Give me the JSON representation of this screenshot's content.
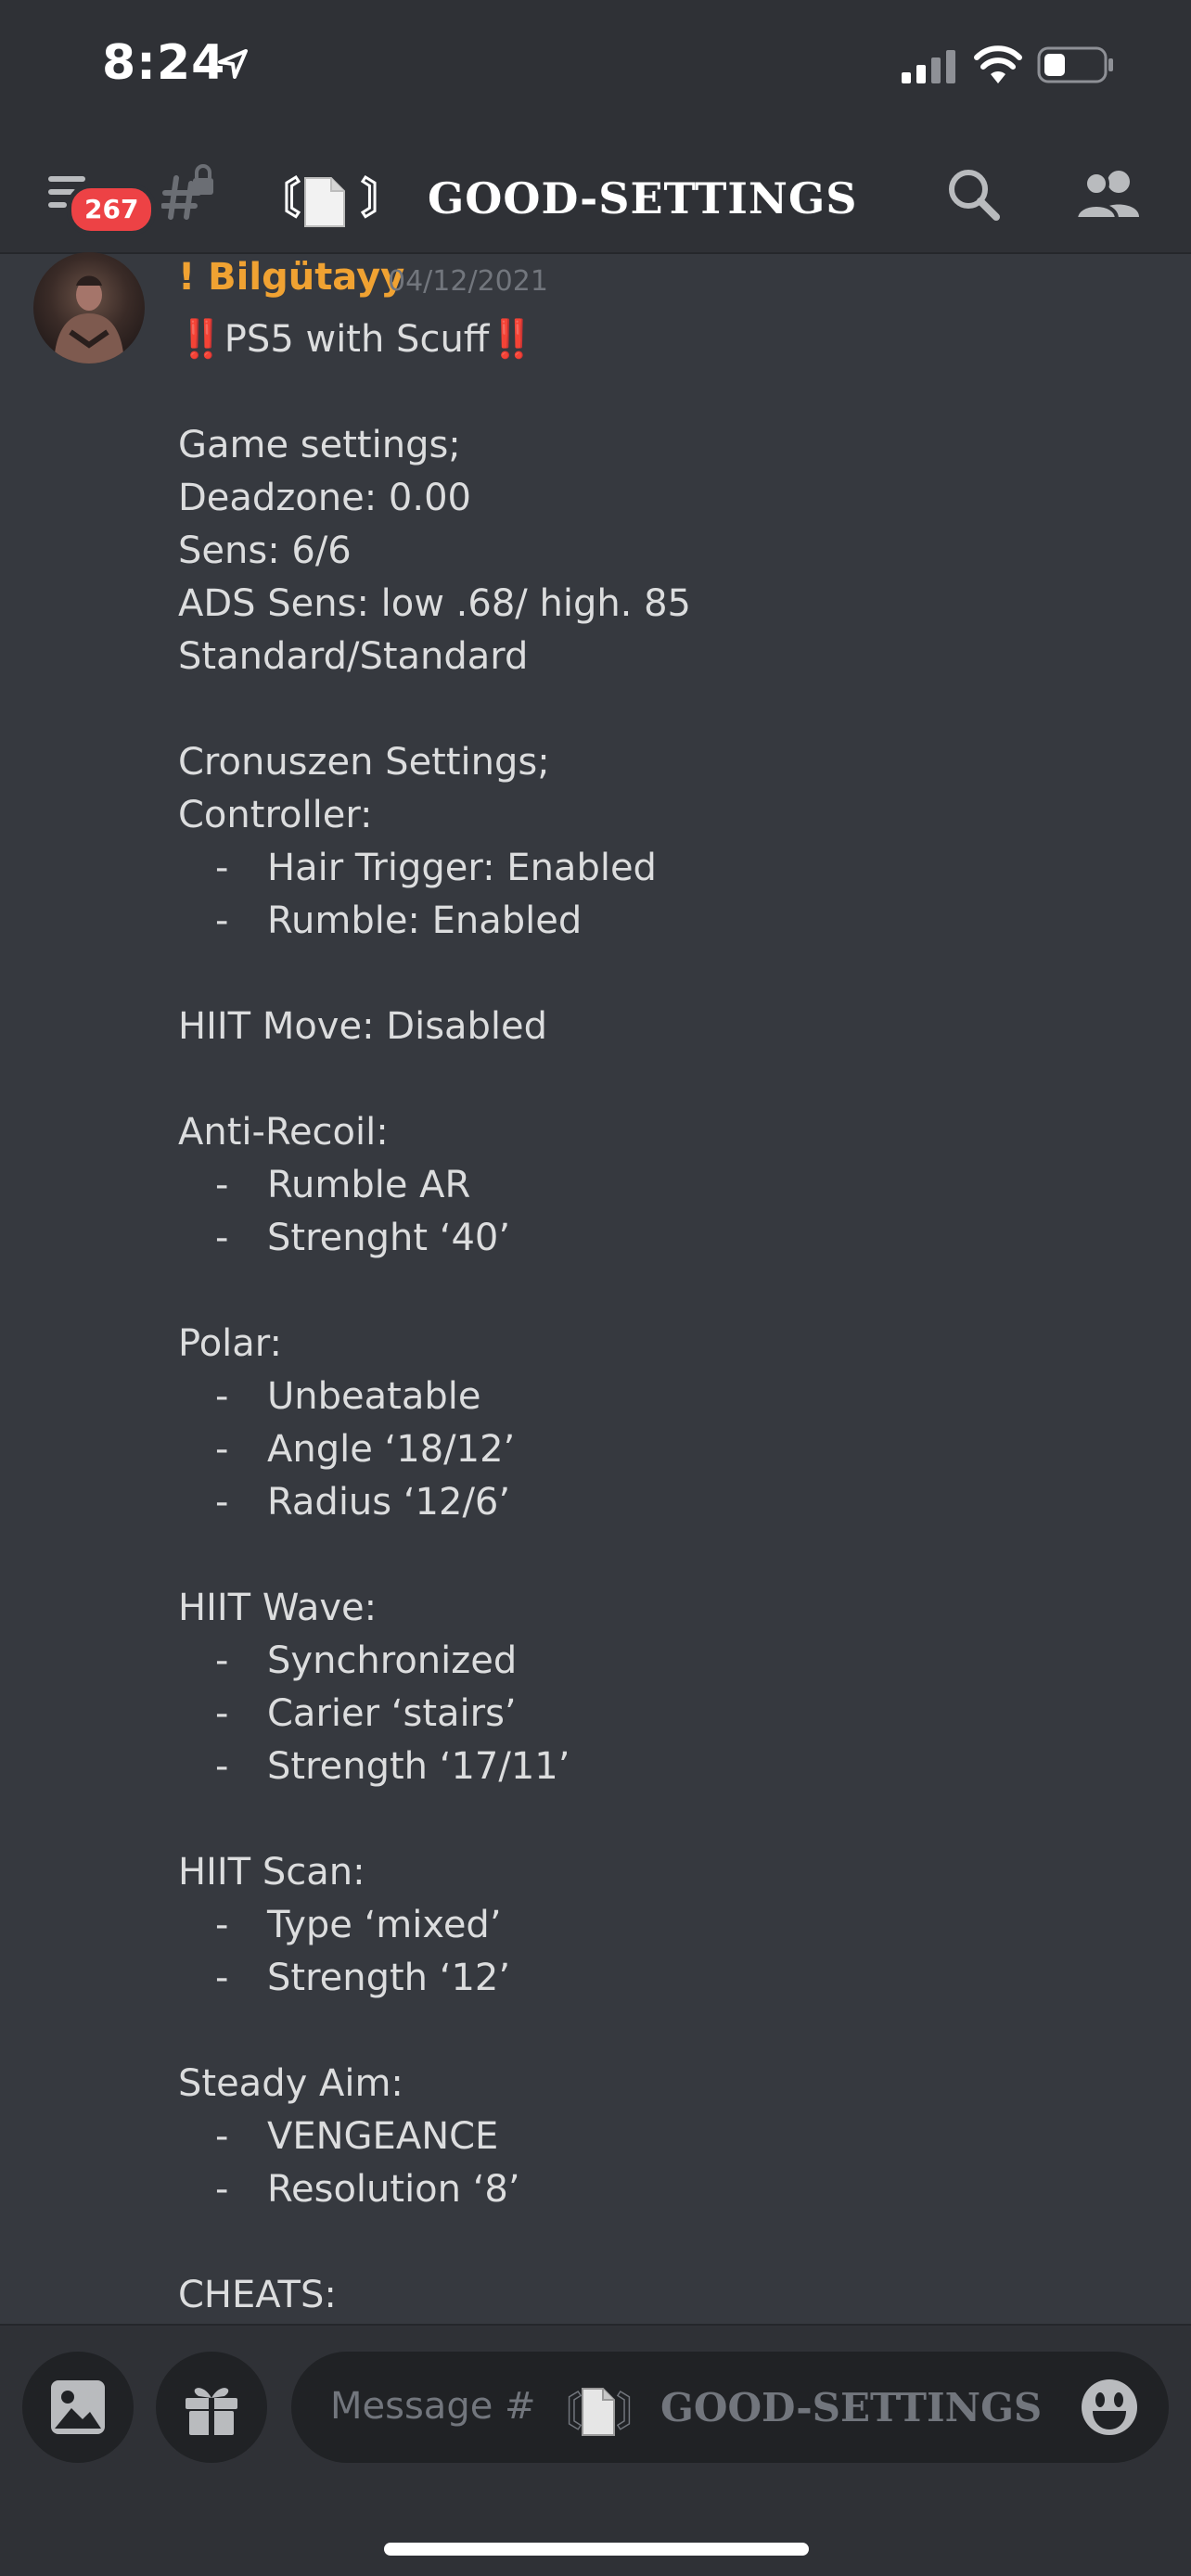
{
  "status_bar": {
    "time": "8:24"
  },
  "header": {
    "badge_count": "267",
    "channel_title": "GOOD-SETTINGS",
    "channel_brackets_left": "〘",
    "channel_brackets_right": "〙"
  },
  "message": {
    "author": "! Bilgütayy",
    "timestamp": "04/12/2021",
    "lines": [
      {
        "kind": "text",
        "text": "‼️PS5 with Scuff‼️"
      },
      {
        "kind": "blank",
        "text": ""
      },
      {
        "kind": "text",
        "text": "Game settings;"
      },
      {
        "kind": "text",
        "text": "Deadzone: 0.00"
      },
      {
        "kind": "text",
        "text": "Sens: 6/6"
      },
      {
        "kind": "text",
        "text": "ADS Sens: low .68/ high. 85"
      },
      {
        "kind": "text",
        "text": "Standard/Standard"
      },
      {
        "kind": "blank",
        "text": ""
      },
      {
        "kind": "text",
        "text": "Cronuszen Settings;"
      },
      {
        "kind": "text",
        "text": "Controller:"
      },
      {
        "kind": "bullet",
        "text": "Hair Trigger: Enabled"
      },
      {
        "kind": "bullet",
        "text": "Rumble: Enabled"
      },
      {
        "kind": "blank",
        "text": ""
      },
      {
        "kind": "text",
        "text": "HIIT Move: Disabled"
      },
      {
        "kind": "blank",
        "text": ""
      },
      {
        "kind": "text",
        "text": "Anti-Recoil:"
      },
      {
        "kind": "bullet",
        "text": "Rumble AR"
      },
      {
        "kind": "bullet",
        "text": "Strenght ‘40’"
      },
      {
        "kind": "blank",
        "text": ""
      },
      {
        "kind": "text",
        "text": "Polar:"
      },
      {
        "kind": "bullet",
        "text": "Unbeatable"
      },
      {
        "kind": "bullet",
        "text": "Angle ‘18/12’"
      },
      {
        "kind": "bullet",
        "text": "Radius ‘12/6’"
      },
      {
        "kind": "blank",
        "text": ""
      },
      {
        "kind": "text",
        "text": "HIIT Wave:"
      },
      {
        "kind": "bullet",
        "text": "Synchronized"
      },
      {
        "kind": "bullet",
        "text": "Carier ‘stairs’"
      },
      {
        "kind": "bullet",
        "text": "Strength ‘17/11’"
      },
      {
        "kind": "blank",
        "text": ""
      },
      {
        "kind": "text",
        "text": "HIIT Scan:"
      },
      {
        "kind": "bullet",
        "text": "Type ‘mixed’"
      },
      {
        "kind": "bullet",
        "text": "Strength ‘12’"
      },
      {
        "kind": "blank",
        "text": ""
      },
      {
        "kind": "text",
        "text": "Steady Aim:"
      },
      {
        "kind": "bullet",
        "text": "VENGEANCE"
      },
      {
        "kind": "bullet",
        "text": "Resolution ‘8’"
      },
      {
        "kind": "blank",
        "text": ""
      },
      {
        "kind": "text",
        "text": "CHEATS:"
      }
    ]
  },
  "composer": {
    "placeholder_prefix": "Message #",
    "placeholder_channel": "GOOD-SETTINGS"
  },
  "icons": {
    "menu": "menu-icon",
    "locked_channel": "hash-lock-icon",
    "search": "search-icon",
    "members": "members-icon",
    "image": "image-icon",
    "gift": "gift-icon",
    "emoji": "emoji-icon"
  },
  "colors": {
    "background": "#36393f",
    "header": "#2f3136",
    "author": "#f0a232",
    "badge": "#ed4245",
    "muted": "#72767d"
  }
}
